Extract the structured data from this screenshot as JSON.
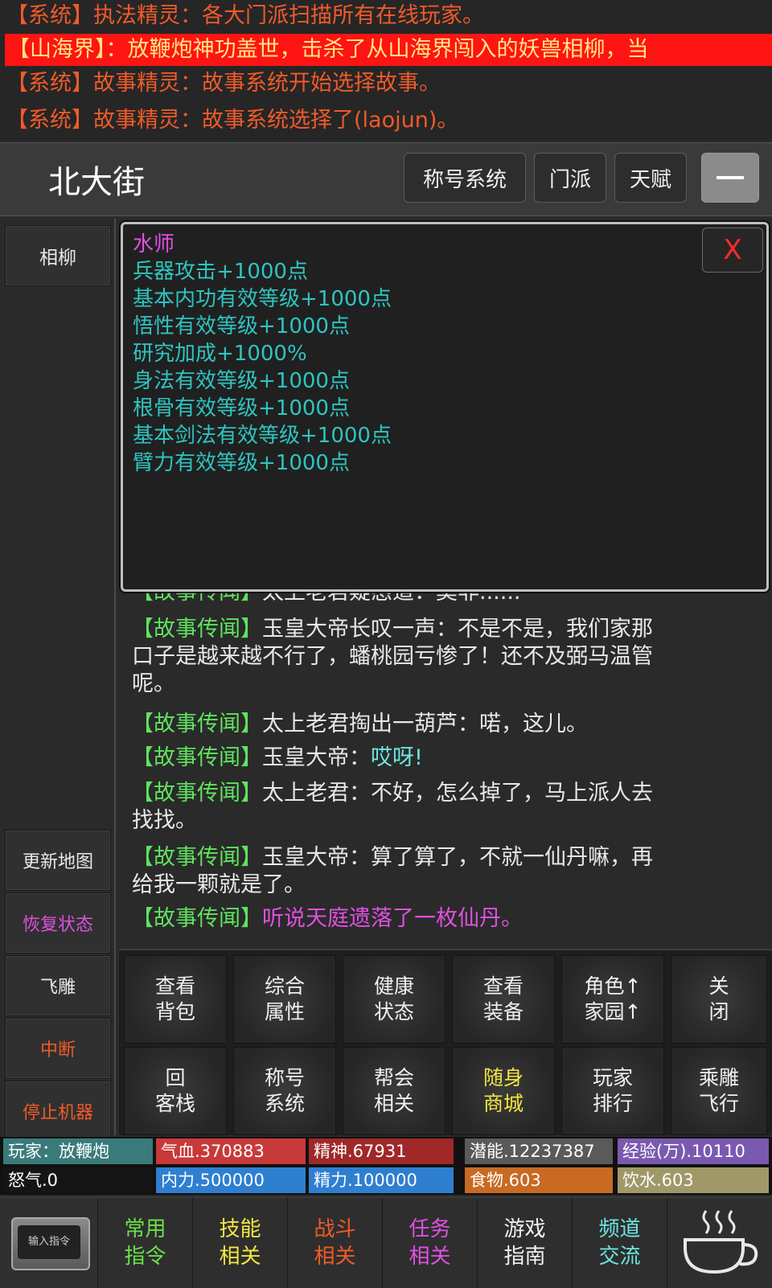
{
  "system_messages": [
    "【系统】执法精灵：各大门派扫描所有在线玩家。",
    "【山海界】：放鞭炮神功盖世，击杀了从山海界闯入的妖兽相柳，当",
    "【系统】故事精灵：故事系统开始选择故事。",
    "【系统】故事精灵：故事系统选择了(laojun)。"
  ],
  "header": {
    "location": "北大街",
    "buttons": [
      "称号系统",
      "门派",
      "天赋"
    ]
  },
  "left_buttons": {
    "npc": "相柳",
    "update_map": "更新地图",
    "restore": "恢复状态",
    "fly": "飞雕",
    "interrupt": "中断",
    "stop_machine": "停止机器"
  },
  "popup": {
    "title": "水师",
    "close": "X",
    "attributes": [
      "兵器攻击+1000点",
      "基本内功有效等级+1000点",
      "悟性有效等级+1000点",
      "研究加成+1000%",
      "身法有效等级+1000点",
      "根骨有效等级+1000点",
      "基本剑法有效等级+1000点",
      "臂力有效等级+1000点"
    ]
  },
  "story": {
    "tag": "【故事传闻】",
    "partial_line": "太上老君疑惑道：莫非......",
    "lines": [
      {
        "line1": "玉皇大帝长叹一声：不是不是，我们家那",
        "line2": "口子是越来越不行了，蟠桃园亏惨了！还不及弼马温管",
        "line3": "呢。"
      },
      {
        "line1": "太上老君掏出一葫芦：喏，这儿。"
      },
      {
        "pre": "玉皇大帝：",
        "highlight": "哎呀!"
      },
      {
        "line1": "太上老君：不好，怎么掉了，马上派人去",
        "line2": "找找。"
      },
      {
        "line1": "玉皇大帝：算了算了，不就一仙丹嘛，再",
        "line2": "给我一颗就是了。"
      },
      {
        "highlight": "听说天庭遗落了一枚仙丹。"
      }
    ]
  },
  "commands": [
    [
      "查看",
      "背包"
    ],
    [
      "综合",
      "属性"
    ],
    [
      "健康",
      "状态"
    ],
    [
      "查看",
      "装备"
    ],
    [
      "角色↑",
      "家园↑"
    ],
    [
      "关",
      "闭"
    ],
    [
      "回",
      "客栈"
    ],
    [
      "称号",
      "系统"
    ],
    [
      "帮会",
      "相关"
    ],
    [
      "随身",
      "商城"
    ],
    [
      "玩家",
      "排行"
    ],
    [
      "乘雕",
      "飞行"
    ]
  ],
  "status": {
    "player": "玩家：放鞭炮",
    "hp": "气血.370883",
    "spirit": "精神.67931",
    "potential": "潜能.12237387",
    "exp": "经验(万).10110",
    "rage": "怒气.0",
    "neili": "内力.500000",
    "jingli": "精力.100000",
    "food": "食物.603",
    "water": "饮水.603"
  },
  "bottom_nav": {
    "input_cmd": "输入指令",
    "items": [
      {
        "l1": "常用",
        "l2": "指令",
        "color": "#6be046"
      },
      {
        "l1": "技能",
        "l2": "相关",
        "color": "#f2e640"
      },
      {
        "l1": "战斗",
        "l2": "相关",
        "color": "#f05a28"
      },
      {
        "l1": "任务",
        "l2": "相关",
        "color": "#e050e0"
      },
      {
        "l1": "游戏",
        "l2": "指南",
        "color": "#f0f0f0"
      },
      {
        "l1": "频道",
        "l2": "交流",
        "color": "#6be6e0"
      }
    ]
  },
  "colors": {
    "system_text": "#f05a28",
    "highlight_bg": "#ff1414",
    "story_tag": "#5fe35f",
    "popup_title": "#e050e0",
    "popup_attr": "#2ec4c0"
  }
}
